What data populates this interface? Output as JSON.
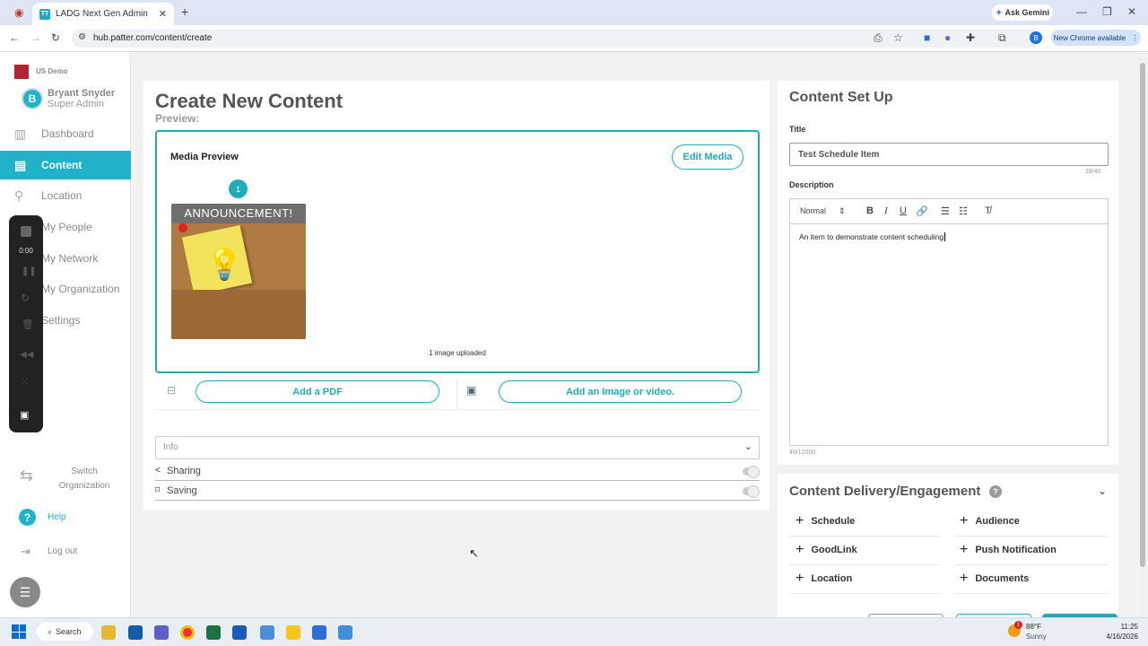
{
  "browser": {
    "tab_title": "LADG Next Gen Admin",
    "url": "hub.patter.com/content/create",
    "ask_gemini": "Ask Gemini",
    "new_chrome": "New Chrome available",
    "profile_initial": "B"
  },
  "sidebar": {
    "org": "US Demo",
    "user_initial": "B",
    "user_name": "Bryant Snyder",
    "user_role": "Super Admin",
    "items": [
      {
        "label": "Dashboard",
        "icon": "bar-chart-icon"
      },
      {
        "label": "Content",
        "icon": "content-icon",
        "active": true
      },
      {
        "label": "Location",
        "icon": "location-pin-icon"
      },
      {
        "label": "My People",
        "icon": "people-icon"
      },
      {
        "label": "My Network",
        "icon": "network-icon"
      },
      {
        "label": "My Organization",
        "icon": "organization-icon"
      },
      {
        "label": "Settings",
        "icon": "gear-icon"
      }
    ],
    "switch_org": "Switch Organization",
    "help": "Help",
    "logout": "Log out"
  },
  "recorder": {
    "time": "0:00"
  },
  "main": {
    "title": "Create New Content",
    "preview_label": "Preview:",
    "media_preview": "Media Preview",
    "edit_media": "Edit Media",
    "badge": "1",
    "thumb_caption": "ANNOUNCEMENT!",
    "uploaded": "1 image uploaded",
    "add_pdf": "Add a PDF",
    "add_image": "Add an Image or video.",
    "info": "Info",
    "sharing": "Sharing",
    "saving": "Saving"
  },
  "setup": {
    "heading": "Content Set Up",
    "title_label": "Title",
    "title_value": "Test Schedule Item",
    "title_count": "18/40",
    "desc_label": "Description",
    "format": "Normal",
    "desc_value": "An item to demonstrate content scheduling",
    "desc_count": "49/12000"
  },
  "delivery": {
    "heading": "Content Delivery/Engagement",
    "items": [
      "Schedule",
      "Audience",
      "GoodLink",
      "Push Notification",
      "Location",
      "Documents"
    ]
  },
  "taskbar": {
    "search": "Search",
    "weather_temp": "88°F",
    "weather_cond": "Sunny",
    "time": "11:25",
    "date": "4/16/2026",
    "weather_badge": "1"
  },
  "colors": {
    "accent": "#1fb2c8",
    "border": "#23aab8"
  }
}
